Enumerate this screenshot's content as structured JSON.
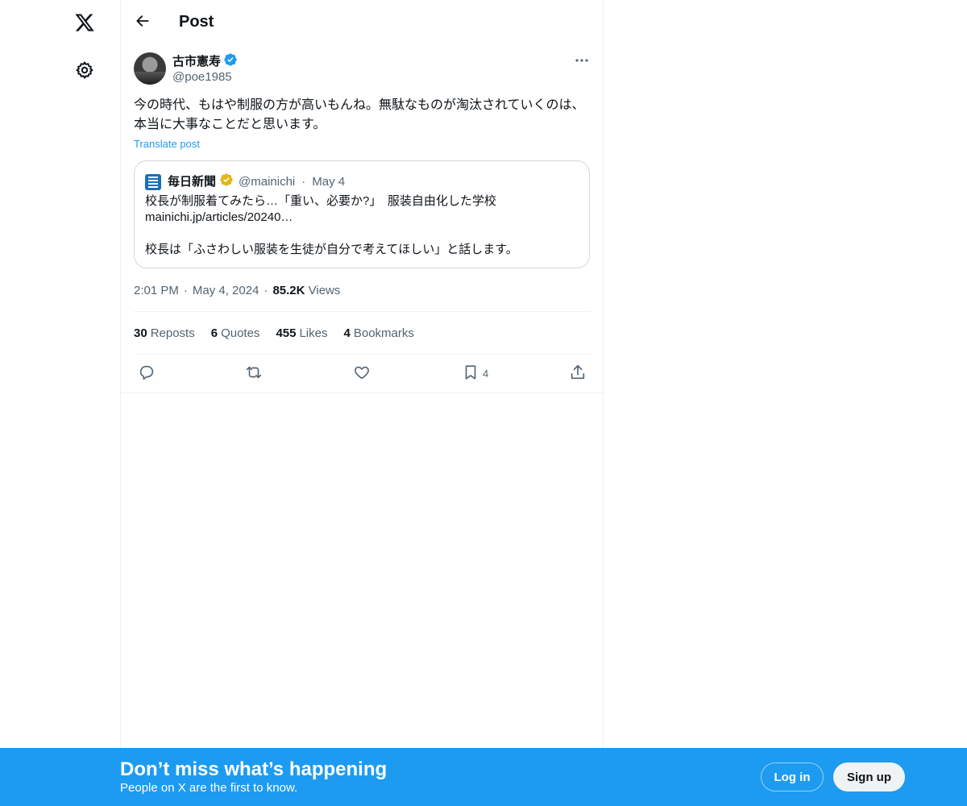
{
  "header": {
    "title": "Post"
  },
  "post": {
    "author": {
      "name": "古市憲寿",
      "handle": "@poe1985",
      "verified_color": "#1d9bf0"
    },
    "text": "今の時代、もはや制服の方が高いもんね。無駄なものが淘汰されていくのは、本当に大事なことだと思います。",
    "translate_label": "Translate post",
    "quote": {
      "name": "毎日新聞",
      "handle": "@mainichi",
      "separator": "·",
      "date": "May 4",
      "verified_color": "#e2b719",
      "line1": "校長が制服着てみたら…「重い、必要か?」　服装自由化した学校",
      "line2": "mainichi.jp/articles/20240…",
      "line3": "校長は「ふさわしい服装を生徒が自分で考えてほしい」と話します。"
    },
    "meta": {
      "time": "2:01 PM",
      "separator": "·",
      "date": "May 4, 2024",
      "views_count": "85.2K",
      "views_label": "Views"
    },
    "stats": {
      "reposts_count": "30",
      "reposts_label": "Reposts",
      "quotes_count": "6",
      "quotes_label": "Quotes",
      "likes_count": "455",
      "likes_label": "Likes",
      "bookmarks_count": "4",
      "bookmarks_label": "Bookmarks"
    },
    "actions": {
      "bookmark_count": "4"
    }
  },
  "bottom_bar": {
    "title": "Don’t miss what’s happening",
    "subtitle": "People on X are the first to know.",
    "login_label": "Log in",
    "signup_label": "Sign up",
    "background": "#1d9bf0"
  },
  "icons": {
    "logo": "x-logo-icon",
    "settings": "gear-icon",
    "back": "arrow-left-icon",
    "more": "more-icon",
    "reply": "reply-icon",
    "repost": "repost-icon",
    "like": "heart-icon",
    "bookmark": "bookmark-icon",
    "share": "share-icon"
  }
}
